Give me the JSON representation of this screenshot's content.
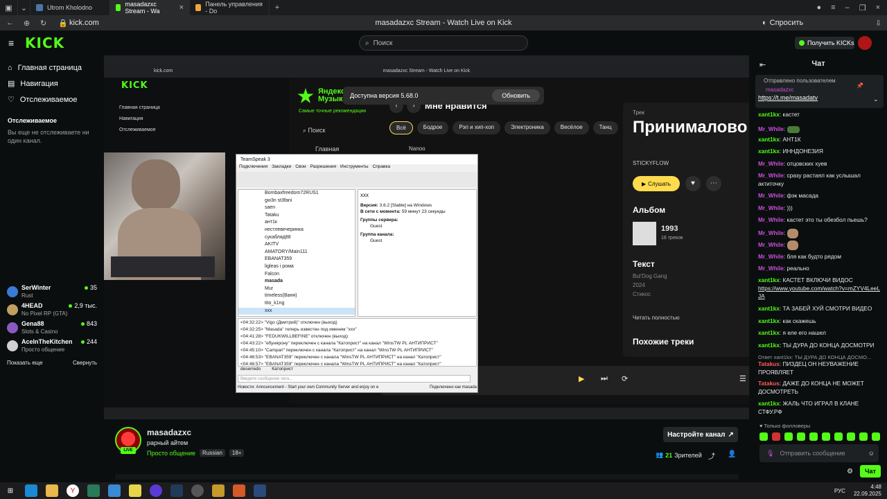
{
  "browser": {
    "tabs": [
      {
        "label": "Utrom Kholodno",
        "color": "#4a76a8"
      },
      {
        "label": "masadazxc Stream - Wa",
        "color": "#53fc18"
      },
      {
        "label": "Панель управления - Do",
        "color": "#f2a33a"
      }
    ],
    "url": "kick.com",
    "page_title": "masadazxc Stream - Watch Live on Kick",
    "ask_label": "Спросить"
  },
  "kick": {
    "logo": "KICK",
    "search_placeholder": "Поиск",
    "get_kicks": "Получить KICKs"
  },
  "sidebar": {
    "nav": [
      {
        "label": "Главная страница",
        "icon": "home-icon"
      },
      {
        "label": "Навигация",
        "icon": "compass-icon"
      },
      {
        "label": "Отслеживаемое",
        "icon": "heart-icon"
      }
    ],
    "following_title": "Отслеживаемое",
    "following_empty": "Вы еще не отслеживаете ни один канал.",
    "channels": [
      {
        "name": "SerWinter",
        "game": "Rust",
        "viewers": "35",
        "color": "#3a7bd5"
      },
      {
        "name": "4HEAD",
        "game": "No Pixel RP (GTA)",
        "viewers": "2,9 тыс.",
        "color": "#c0a060"
      },
      {
        "name": "Gena88",
        "game": "Slots & Casino",
        "viewers": "843",
        "color": "#8a5ac2"
      },
      {
        "name": "AceInTheKitchen",
        "game": "Просто общение",
        "viewers": "244",
        "color": "#d0d0d0"
      }
    ],
    "show_more": "Показать еще",
    "collapse": "Свернуть"
  },
  "stream": {
    "inner_title": "masadazxc Stream - Watch Live on Kick",
    "inner_url": "kick.com",
    "update_text": "Доступна версия 5.68.0",
    "update_btn": "Обновить",
    "ym": {
      "logo": "Яндекс Музыка",
      "slogan": "Самые точные рекомендации",
      "search": "Поиск",
      "main": "Главная",
      "heading": "Мне нравится",
      "genres": [
        "Всё",
        "Бодрое",
        "Рэп и хип-хоп",
        "Электроника",
        "Весёлое",
        "Танц"
      ],
      "track_label": "Трек",
      "track_title": "Принималово !",
      "artist": "STICKYFLOW",
      "listen": "Слушать",
      "album_h": "Альбом",
      "album_year": "1993",
      "album_tracks": "16 треков",
      "text_h": "Текст",
      "lyric_lines": [
        "Bul'Dog Gang",
        "2024",
        "Стикос"
      ],
      "read_full": "Читать полностью",
      "similar": "Похожие треки",
      "nanoo": "Nanoo"
    },
    "teamspeak": {
      "title": "TeamSpeak 3",
      "menu": [
        "Подключения",
        "Закладки",
        "Свои",
        "Разрешения",
        "Инструменты",
        "Справка"
      ],
      "users": [
        "Bombaxfreedom72RUS1",
        "gw3n st3fani",
        "saen",
        "Tataku",
        "ант1к",
        "нестлевечеринка",
        "сукабляд88",
        "AKITV",
        "AMATORY/Main111",
        "EBANAT359",
        "ligleas i рома",
        "Falcon",
        "masada",
        "Mur",
        "timeless(Ваня)",
        "tito_k1ng",
        "xxx"
      ],
      "selected_user": "xxx",
      "info_version_label": "Версия:",
      "info_version": "3.6.2 [Stable] на Windows",
      "info_online_label": "В сети с момента:",
      "info_online": "59 минут 23 секунды",
      "server_groups_label": "Группы сервера:",
      "server_group": "Guest",
      "channel_groups_label": "Группа канала:",
      "channel_group": "Guest",
      "log": [
        "<04:32:22> \"Vigo (Дмитрий)\" отключен (выход)",
        "<04:32:25> \"Masada\" теперь известен под именем \"xxx\"",
        "<04:41:28> \"FEDUKWILLBEFINE\" отключен (выход)",
        "<04:43:22> \"ебунярону\" переключен с канала \"Катоприст\" на канал \"WinsTW PL АНТИПРИСТ\"",
        "<04:45:10> \"Campari\" переключен с канала \"Катоприст\" на канал \"WinsTW PL АНТИПРИСТ\"",
        "<04:46:53> \"EBANAT359\" переключен с канала \"WinsTW PL АНТИПРИСТ\" на канал \"Катоприст\"",
        "<04:46:57> \"EBANAT359\" переключен с канала \"WinsTW PL АНТИПРИСТ\" на канал \"Катоприст\""
      ],
      "tabs": [
        "deserredo",
        "Катоприст"
      ],
      "input_placeholder": "Введите сообщение чата...",
      "status_news": "Новости: Announcement - Start your own Community Server and enjoy on e",
      "status_conn": "Подключено как masada"
    }
  },
  "channel": {
    "name": "masadazxc",
    "title": "рарный айтем",
    "category": "Просто общение",
    "tags": [
      "Russian",
      "18+"
    ],
    "live": "LIVE",
    "setup_btn": "Настройте канал",
    "viewers_count": "21",
    "viewers_label": "Зрителей"
  },
  "chat": {
    "title": "Чат",
    "pinned_by": "Отправлено пользователем",
    "pinned_user": "masadazxc",
    "pinned_link": "https://t.me/masadatv",
    "messages": [
      {
        "user": "xant1kx",
        "kind": "g",
        "text": "кастет"
      },
      {
        "user": "Mr_Whilе",
        "kind": "p",
        "text": ""
      },
      {
        "user": "xant1kx",
        "kind": "g",
        "text": "АНТ1К"
      },
      {
        "user": "xant1kx",
        "kind": "g",
        "text": "ИННДОНЕЗИЯ"
      },
      {
        "user": "Mr_Whilе",
        "kind": "p",
        "text": "отцовских хуев"
      },
      {
        "user": "Mr_Whilе",
        "kind": "p",
        "text": "сразу растаял как услышал актиточку"
      },
      {
        "user": "Mr_Whilе",
        "kind": "p",
        "text": "фэк масада"
      },
      {
        "user": "Mr_Whilе",
        "kind": "p",
        "text": ")))"
      },
      {
        "user": "Mr_Whilе",
        "kind": "p",
        "text": "кастет это ты обезбол пьешь?"
      },
      {
        "user": "Mr_Whilе",
        "kind": "p",
        "text": ""
      },
      {
        "user": "Mr_Whilе",
        "kind": "p",
        "text": ""
      },
      {
        "user": "Mr_Whilе",
        "kind": "p",
        "text": "бля как будто рядом"
      },
      {
        "user": "Mr_Whilе",
        "kind": "p",
        "text": "реально"
      },
      {
        "user": "xant1kx",
        "kind": "g",
        "text": "КАСТЕТ ВКЛЮЧИ ВИДОС"
      },
      {
        "user": "xant1kx",
        "kind": "g",
        "text": "ТА ЗАБЕЙ ХУЙ СМОТРИ ВИДЕО"
      },
      {
        "user": "xant1kx",
        "kind": "g",
        "text": "как скажешь"
      },
      {
        "user": "xant1kx",
        "kind": "g",
        "text": "я еле его нашел"
      },
      {
        "user": "xant1kx",
        "kind": "g",
        "text": "ТЫ ДУРА ДО КОНЦА ДОСМОТРИ"
      },
      {
        "user": "Tatakus",
        "kind": "r",
        "text": "ПИЗДЕЦ ОН НЕУВАЖЕНИЕ ПРОЯВЛЯЕТ"
      },
      {
        "user": "Tatakus",
        "kind": "r",
        "text": "ДАЖЕ ДО КОНЦА НЕ МОЖЕТ ДОСМОТРЕТЬ"
      },
      {
        "user": "xant1kx",
        "kind": "g",
        "text": "ЖАЛЬ ЧТО ИГРАЛ В КЛАНЕ СТФУ.РФ"
      }
    ],
    "yt_link": "https://www.youtube.com/watch?v=mZYV4LeeLJA",
    "reply_text": "Ответ xant1kx: ТЫ ДУРА ДО КОНЦА ДОСМО...",
    "followers_only": "Только фолловеры",
    "input_placeholder": "Отправить сообщение",
    "send_btn": "Чат"
  },
  "taskbar": {
    "lang": "РУС",
    "time": "4:48",
    "date": "22.09.2025"
  }
}
